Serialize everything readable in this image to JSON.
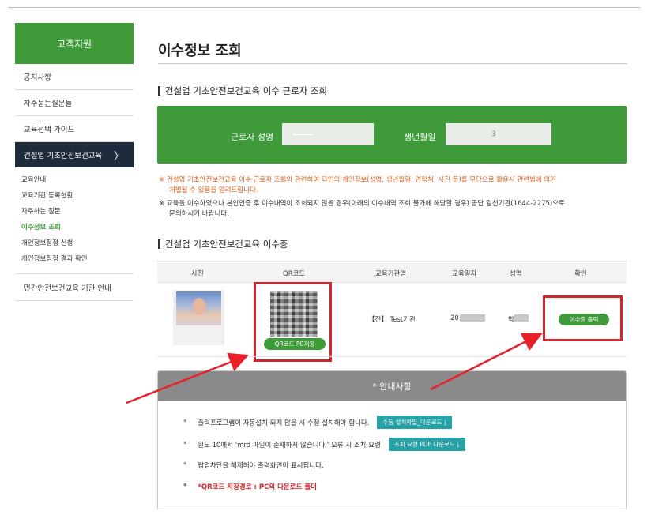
{
  "sidebar": {
    "header": "고객지원",
    "items": [
      "공지사항",
      "자주묻는질문들",
      "교육선택 가이드"
    ],
    "active": {
      "label": "건설업 기초안전보건교육",
      "chevron": "chevron-right-icon"
    },
    "subitems": [
      "교육안내",
      "교육기관 등록현황",
      "자주하는 질문",
      "이수정보 조회",
      "개인정보정정 신청",
      "개인정보정정 결과 확인"
    ],
    "active_sub_index": 3,
    "last": "민간안전보건교육 기관 안내"
  },
  "main": {
    "title": "이수정보 조회",
    "search_section_title": "건설업 기초안전보건교육 이수 근로자 조회",
    "search": {
      "name_label": "근로자 성명",
      "birth_label": "생년월일",
      "birth_value": "3"
    },
    "notice_red": [
      "※ 건설업 기초안전보건교육 이수 근로자 조회와 관련하여 타인의 개인정보(성명, 생년월일, 연락처, 사진 등)를 무단으로 활용시 관련법에 의거",
      "처벌될 수 있음을 알려드립니다."
    ],
    "notice_gray": [
      "※ 교육을 이수하였으나 본인인증 후 이수내역이 조회되지 않을 경우(아래의 이수내역 조회 불가에 해당할 경우) 공단 일선기관(1644-2275)으로",
      "문의하시기 바랍니다."
    ],
    "cert_section_title": "건설업 기초안전보건교육 이수증",
    "table": {
      "headers": [
        "사진",
        "QR코드",
        "교육기관명",
        "교육일자",
        "성명",
        "확인"
      ],
      "row": {
        "qr_button": "QR코드 PC저장",
        "institution": "【전】 Test기관",
        "date_prefix": "20",
        "name_prefix": "박",
        "print_button": "이수증 출력"
      }
    },
    "info": {
      "header": "* 안내사항",
      "lines": [
        {
          "text": "출력프로그램이 자동설치 되지 않을 시 수정 설치해야 합니다.",
          "button": "수동 설치파일_다운로드 ⤓"
        },
        {
          "text": "윈도 10에서 'mrd 파일이 존재하지 않습니다.' 오류 시 조치 요령",
          "button": "조치 요령 PDF 다운로드 ⤓"
        },
        {
          "text": "팝업차단을 해제해야 출력화면이 표시됩니다."
        },
        {
          "text": "*QR코드 저장경로 : PC의 다운로드 폴더"
        }
      ],
      "bullet": "*"
    }
  },
  "colors": {
    "green": "#3f9b3a",
    "navy": "#1d2b3a",
    "red": "#d0252c",
    "teal": "#27a3a8",
    "orange": "#e25c1b"
  }
}
